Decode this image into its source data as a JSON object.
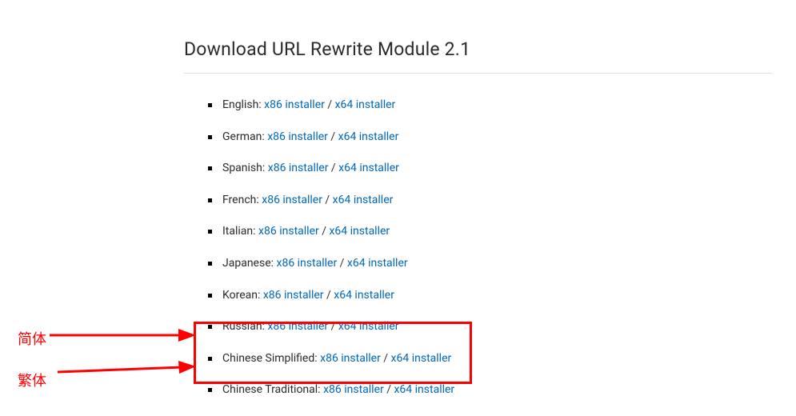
{
  "heading": "Download URL Rewrite Module 2.1",
  "items": [
    {
      "lang": "English:",
      "x86": "x86 installer",
      "sep": " / ",
      "x64": "x64 installer"
    },
    {
      "lang": "German:",
      "x86": "x86 installer",
      "sep": " / ",
      "x64": "x64 installer"
    },
    {
      "lang": "Spanish:",
      "x86": "x86 installer",
      "sep": " / ",
      "x64": "x64 installer"
    },
    {
      "lang": "French:",
      "x86": "x86 installer",
      "sep": " / ",
      "x64": "x64 installer"
    },
    {
      "lang": "Italian:",
      "x86": "x86 installer",
      "sep": " / ",
      "x64": "x64 installer"
    },
    {
      "lang": "Japanese:",
      "x86": "x86 installer",
      "sep": " / ",
      "x64": "x64 installer"
    },
    {
      "lang": "Korean:",
      "x86": "x86 installer",
      "sep": " / ",
      "x64": "x64 installer"
    },
    {
      "lang": "Russian:",
      "x86": "x86 installer",
      "sep": " / ",
      "x64": "x64 installer"
    },
    {
      "lang": "Chinese Simplified:",
      "x86": "x86 installer",
      "sep": " / ",
      "x64": "x64 installer"
    },
    {
      "lang": "Chinese Traditional:",
      "x86": "x86 installer",
      "sep": " / ",
      "x64": "x64 installer"
    }
  ],
  "annotations": {
    "label1": "简体",
    "label2": "繁体"
  },
  "colors": {
    "link": "#0067b8",
    "highlight": "#ff0000"
  }
}
